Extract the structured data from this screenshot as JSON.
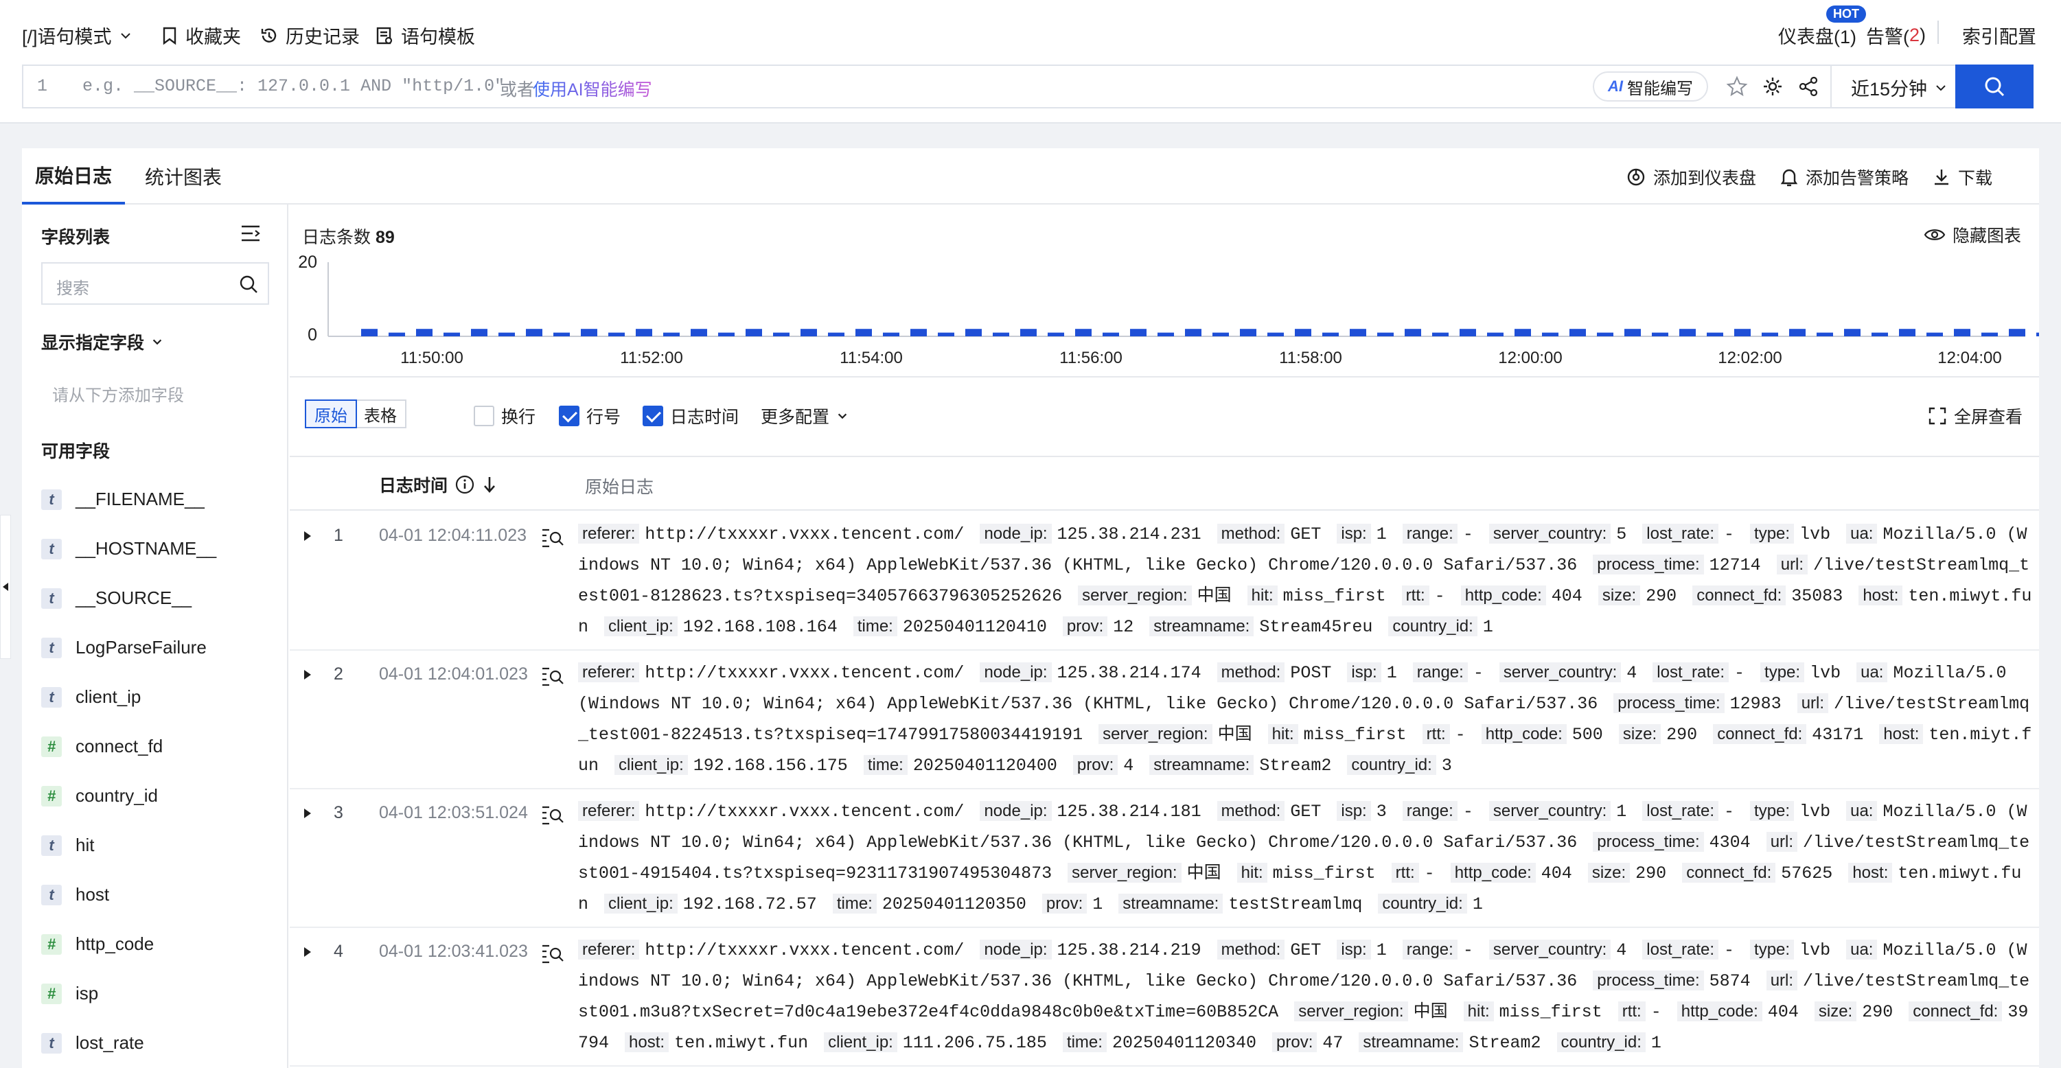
{
  "toolbar": {
    "mode": "[/]语句模式",
    "favorites": "收藏夹",
    "history": "历史记录",
    "template": "语句模板",
    "dashboard": "仪表盘(1)",
    "hot": "HOT",
    "alarm": "告警(",
    "alarm_count": "2",
    "alarm_close": ")",
    "index_config": "索引配置"
  },
  "query": {
    "line_no": "1",
    "placeholder": "e.g. __SOURCE__: 127.0.0.1 AND \"http/1.0\"",
    "or": "或者",
    "ai_link": "使用AI智能编写",
    "ai_btn": "智能编写",
    "time_range": "近15分钟"
  },
  "tabs": {
    "raw": "原始日志",
    "chart": "统计图表",
    "add_dashboard": "添加到仪表盘",
    "add_alarm": "添加告警策略",
    "download": "下载"
  },
  "sidebar": {
    "title": "字段列表",
    "search_placeholder": "搜索",
    "show_fields": "显示指定字段",
    "add_hint": "请从下方添加字段",
    "available": "可用字段",
    "fields": [
      {
        "type": "t",
        "name": "__FILENAME__"
      },
      {
        "type": "t",
        "name": "__HOSTNAME__"
      },
      {
        "type": "t",
        "name": "__SOURCE__"
      },
      {
        "type": "t",
        "name": "LogParseFailure"
      },
      {
        "type": "t",
        "name": "client_ip"
      },
      {
        "type": "#",
        "name": "connect_fd"
      },
      {
        "type": "#",
        "name": "country_id"
      },
      {
        "type": "t",
        "name": "hit"
      },
      {
        "type": "t",
        "name": "host"
      },
      {
        "type": "#",
        "name": "http_code"
      },
      {
        "type": "#",
        "name": "isp"
      },
      {
        "type": "t",
        "name": "lost_rate"
      }
    ]
  },
  "histogram": {
    "count_label": "日志条数",
    "count": "89",
    "hide": "隐藏图表"
  },
  "chart_data": {
    "type": "bar",
    "y_ticks": [
      "20",
      "0"
    ],
    "ylim": [
      0,
      20
    ],
    "x_ticks": [
      "11:50:00",
      "11:52:00",
      "11:54:00",
      "11:56:00",
      "11:58:00",
      "12:00:00",
      "12:02:00",
      "12:04:00"
    ],
    "values": [
      2,
      1,
      2,
      1,
      2,
      1,
      2,
      1,
      2,
      1,
      2,
      1,
      2,
      1,
      2,
      1,
      2,
      1,
      2,
      1,
      2,
      1,
      2,
      1,
      2,
      1,
      2,
      1,
      2,
      1,
      2,
      1,
      2,
      1,
      2,
      1,
      2,
      1,
      2,
      1,
      2,
      1,
      2,
      1,
      2,
      1,
      2,
      1,
      2,
      1,
      2,
      1,
      2,
      1,
      2,
      1,
      2,
      1,
      2,
      1,
      2,
      1,
      2,
      1,
      2,
      1,
      2,
      1,
      2,
      1,
      2,
      1,
      2,
      1,
      2,
      1,
      2,
      1,
      2,
      1,
      2,
      1,
      2,
      1,
      2,
      1,
      2,
      1,
      2,
      1
    ]
  },
  "view": {
    "raw": "原始",
    "table": "表格",
    "wrap": "换行",
    "line_no": "行号",
    "log_time": "日志时间",
    "more": "更多配置",
    "fullscreen": "全屏查看"
  },
  "table": {
    "col_time": "日志时间",
    "col_raw": "原始日志"
  },
  "rows": [
    {
      "n": "1",
      "time": "04-01 12:04:11.023",
      "kv": [
        [
          "referer:",
          "http://txxxxr.vxxx.tencent.com/"
        ],
        [
          "node_ip:",
          "125.38.214.231"
        ],
        [
          "method:",
          "GET"
        ],
        [
          "isp:",
          "1"
        ],
        [
          "range:",
          "-"
        ],
        [
          "server_country:",
          "5"
        ],
        [
          "lost_rate:",
          "-"
        ],
        [
          "type:",
          "lvb"
        ],
        [
          "ua:",
          "Mozilla/5.0 (Windows NT 10.0; Win64; x64) AppleWebKit/537.36 (KHTML, like Gecko) Chrome/120.0.0.0 Safari/537.36"
        ],
        [
          "process_time:",
          "12714"
        ],
        [
          "url:",
          "/live/testStreamlmq_test001-8128623.ts?txspiseq=34057663796305252626"
        ],
        [
          "server_region:",
          "中国"
        ],
        [
          "hit:",
          "miss_first"
        ],
        [
          "rtt:",
          "-"
        ],
        [
          "http_code:",
          "404"
        ],
        [
          "size:",
          "290"
        ],
        [
          "connect_fd:",
          "35083"
        ],
        [
          "host:",
          "ten.miwyt.fun"
        ],
        [
          "client_ip:",
          "192.168.108.164"
        ],
        [
          "time:",
          "20250401120410"
        ],
        [
          "prov:",
          "12"
        ],
        [
          "streamname:",
          "Stream45reu"
        ],
        [
          "country_id:",
          "1"
        ]
      ]
    },
    {
      "n": "2",
      "time": "04-01 12:04:01.023",
      "kv": [
        [
          "referer:",
          "http://txxxxr.vxxx.tencent.com/"
        ],
        [
          "node_ip:",
          "125.38.214.174"
        ],
        [
          "method:",
          "POST"
        ],
        [
          "isp:",
          "1"
        ],
        [
          "range:",
          "-"
        ],
        [
          "server_country:",
          "4"
        ],
        [
          "lost_rate:",
          "-"
        ],
        [
          "type:",
          "lvb"
        ],
        [
          "ua:",
          "Mozilla/5.0 (Windows NT 10.0; Win64; x64) AppleWebKit/537.36 (KHTML, like Gecko) Chrome/120.0.0.0 Safari/537.36"
        ],
        [
          "process_time:",
          "12983"
        ],
        [
          "url:",
          "/live/testStreamlmq_test001-8224513.ts?txspiseq=17479917580034419191"
        ],
        [
          "server_region:",
          "中国"
        ],
        [
          "hit:",
          "miss_first"
        ],
        [
          "rtt:",
          "-"
        ],
        [
          "http_code:",
          "500"
        ],
        [
          "size:",
          "290"
        ],
        [
          "connect_fd:",
          "43171"
        ],
        [
          "host:",
          "ten.miyt.fun"
        ],
        [
          "client_ip:",
          "192.168.156.175"
        ],
        [
          "time:",
          "20250401120400"
        ],
        [
          "prov:",
          "4"
        ],
        [
          "streamname:",
          "Stream2"
        ],
        [
          "country_id:",
          "3"
        ]
      ]
    },
    {
      "n": "3",
      "time": "04-01 12:03:51.024",
      "kv": [
        [
          "referer:",
          "http://txxxxr.vxxx.tencent.com/"
        ],
        [
          "node_ip:",
          "125.38.214.181"
        ],
        [
          "method:",
          "GET"
        ],
        [
          "isp:",
          "3"
        ],
        [
          "range:",
          "-"
        ],
        [
          "server_country:",
          "1"
        ],
        [
          "lost_rate:",
          "-"
        ],
        [
          "type:",
          "lvb"
        ],
        [
          "ua:",
          "Mozilla/5.0 (Windows NT 10.0; Win64; x64) AppleWebKit/537.36 (KHTML, like Gecko) Chrome/120.0.0.0 Safari/537.36"
        ],
        [
          "process_time:",
          "4304"
        ],
        [
          "url:",
          "/live/testStreamlmq_test001-4915404.ts?txspiseq=92311731907495304873"
        ],
        [
          "server_region:",
          "中国"
        ],
        [
          "hit:",
          "miss_first"
        ],
        [
          "rtt:",
          "-"
        ],
        [
          "http_code:",
          "404"
        ],
        [
          "size:",
          "290"
        ],
        [
          "connect_fd:",
          "57625"
        ],
        [
          "host:",
          "ten.miwyt.fun"
        ],
        [
          "client_ip:",
          "192.168.72.57"
        ],
        [
          "time:",
          "20250401120350"
        ],
        [
          "prov:",
          "1"
        ],
        [
          "streamname:",
          "testStreamlmq"
        ],
        [
          "country_id:",
          "1"
        ]
      ]
    },
    {
      "n": "4",
      "time": "04-01 12:03:41.023",
      "kv": [
        [
          "referer:",
          "http://txxxxr.vxxx.tencent.com/"
        ],
        [
          "node_ip:",
          "125.38.214.219"
        ],
        [
          "method:",
          "GET"
        ],
        [
          "isp:",
          "1"
        ],
        [
          "range:",
          "-"
        ],
        [
          "server_country:",
          "4"
        ],
        [
          "lost_rate:",
          "-"
        ],
        [
          "type:",
          "lvb"
        ],
        [
          "ua:",
          "Mozilla/5.0 (Windows NT 10.0; Win64; x64) AppleWebKit/537.36 (KHTML, like Gecko) Chrome/120.0.0.0 Safari/537.36"
        ],
        [
          "process_time:",
          "5874"
        ],
        [
          "url:",
          "/live/testStreamlmq_test001.m3u8?txSecret=7d0c4a19ebe372e4f4c0dda9848c0b0e&txTime=60B852CA"
        ],
        [
          "server_region:",
          "中国"
        ],
        [
          "hit:",
          "miss_first"
        ],
        [
          "rtt:",
          "-"
        ],
        [
          "http_code:",
          "404"
        ],
        [
          "size:",
          "290"
        ],
        [
          "connect_fd:",
          "39794"
        ],
        [
          "host:",
          "ten.miwyt.fun"
        ],
        [
          "client_ip:",
          "111.206.75.185"
        ],
        [
          "time:",
          "20250401120340"
        ],
        [
          "prov:",
          "47"
        ],
        [
          "streamname:",
          "Stream2"
        ],
        [
          "country_id:",
          "1"
        ]
      ]
    }
  ],
  "colors": {
    "accent": "#1c58d9",
    "bar": "#1f4fd6",
    "danger": "#d9363e"
  }
}
